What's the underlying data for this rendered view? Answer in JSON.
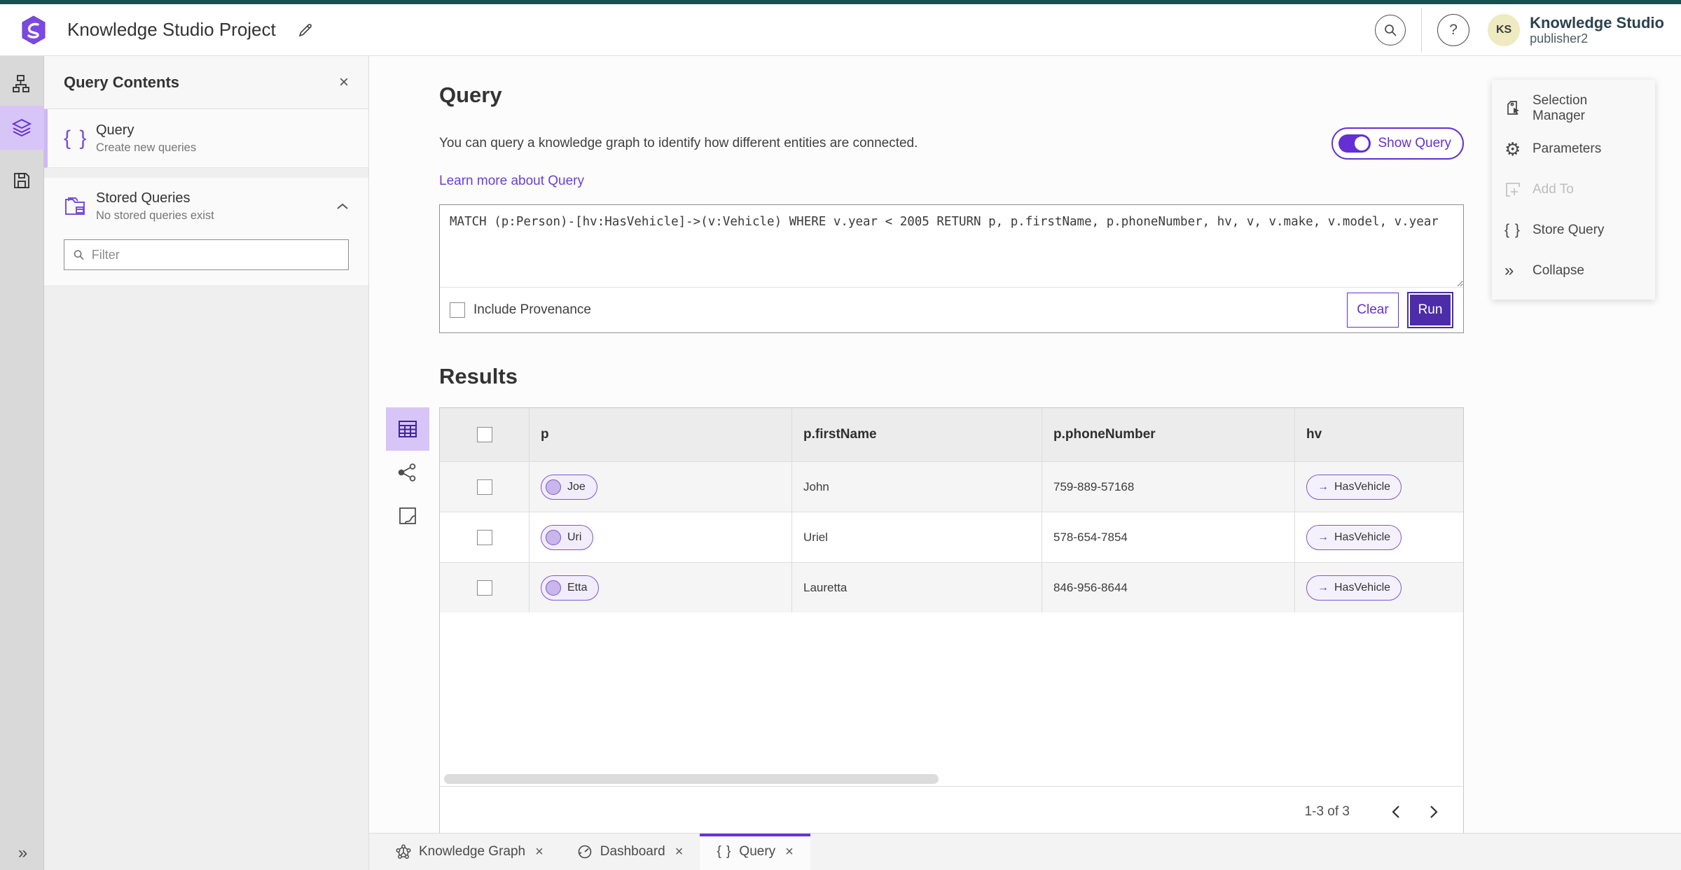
{
  "theme": {
    "top_accent": "#17504f",
    "accent_purple": "#6430d4",
    "deep_purple": "#4c2ca8",
    "active_highlight": "#d8c5f8",
    "pill_fill": "#f2edfb",
    "pill_border": "#7c57cf"
  },
  "header": {
    "title": "Knowledge Studio Project",
    "product": "Knowledge Studio",
    "user": "publisher2",
    "avatar_initials": "KS",
    "help_glyph": "?"
  },
  "panel": {
    "title": "Query Contents",
    "close_glyph": "×",
    "query_item": {
      "title": "Query",
      "subtitle": "Create new queries"
    },
    "stored_item": {
      "title": "Stored Queries",
      "subtitle": "No stored queries exist"
    },
    "filter_placeholder": "Filter"
  },
  "query": {
    "title": "Query",
    "description": "You can query a knowledge graph to identify how different entities are connected.",
    "learn_more": "Learn more about Query",
    "show_query_label": "Show Query",
    "text": "MATCH (p:Person)-[hv:HasVehicle]->(v:Vehicle) WHERE v.year < 2005 RETURN p, p.firstName, p.phoneNumber, hv, v, v.make, v.model, v.year",
    "include_provenance": "Include Provenance",
    "clear_label": "Clear",
    "run_label": "Run"
  },
  "results": {
    "title": "Results",
    "columns": [
      "p",
      "p.firstName",
      "p.phoneNumber",
      "hv"
    ],
    "rows": [
      {
        "p": "Joe",
        "firstName": "John",
        "phoneNumber": "759-889-57168",
        "hv": "HasVehicle"
      },
      {
        "p": "Uri",
        "firstName": "Uriel",
        "phoneNumber": "578-654-7854",
        "hv": "HasVehicle"
      },
      {
        "p": "Etta",
        "firstName": "Lauretta",
        "phoneNumber": "846-956-8644",
        "hv": "HasVehicle"
      }
    ],
    "edge_arrow": "→",
    "pagination": "1-3 of 3"
  },
  "actions": {
    "items": [
      {
        "label": "Selection Manager"
      },
      {
        "label": "Parameters"
      },
      {
        "label": "Add To"
      },
      {
        "label": "Store Query"
      },
      {
        "label": "Collapse"
      }
    ],
    "gear_glyph": "⚙",
    "braces_glyph": "{ }",
    "collapse_glyph": "»"
  },
  "glyphs": {
    "braces": "{ }",
    "expand": "»"
  },
  "tabs": [
    {
      "label": "Knowledge Graph"
    },
    {
      "label": "Dashboard"
    },
    {
      "label": "Query"
    }
  ],
  "tab_close_glyph": "×"
}
